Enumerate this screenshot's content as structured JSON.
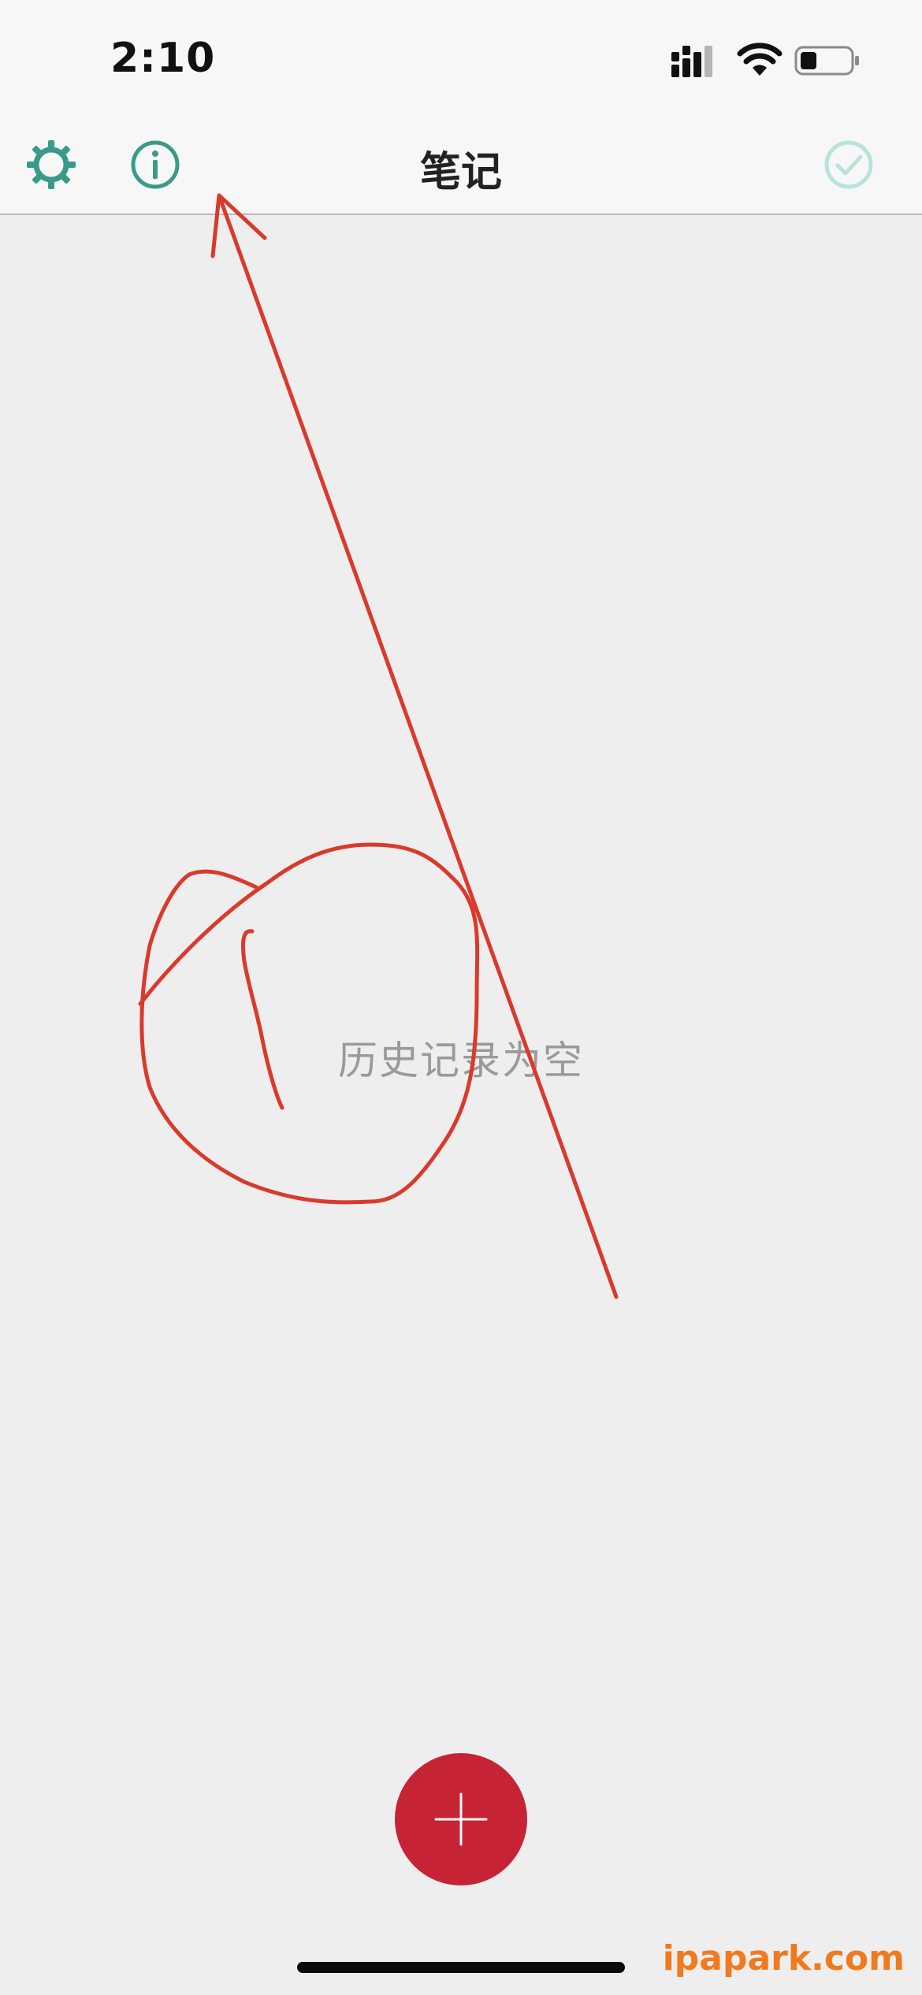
{
  "status_bar": {
    "time": "2:10"
  },
  "nav_bar": {
    "title": "笔记",
    "settings_icon": "gear-icon",
    "info_icon": "info-icon",
    "done_icon": "check-circle-icon"
  },
  "main": {
    "empty_message": "历史记录为空"
  },
  "fab": {
    "icon": "plus-icon",
    "color": "#c62335"
  },
  "watermark": {
    "text": "ipapark.com"
  },
  "colors": {
    "accent": "#3a9a8a",
    "done_disabled": "#b7e3de",
    "annotation": "#d93a2b"
  }
}
